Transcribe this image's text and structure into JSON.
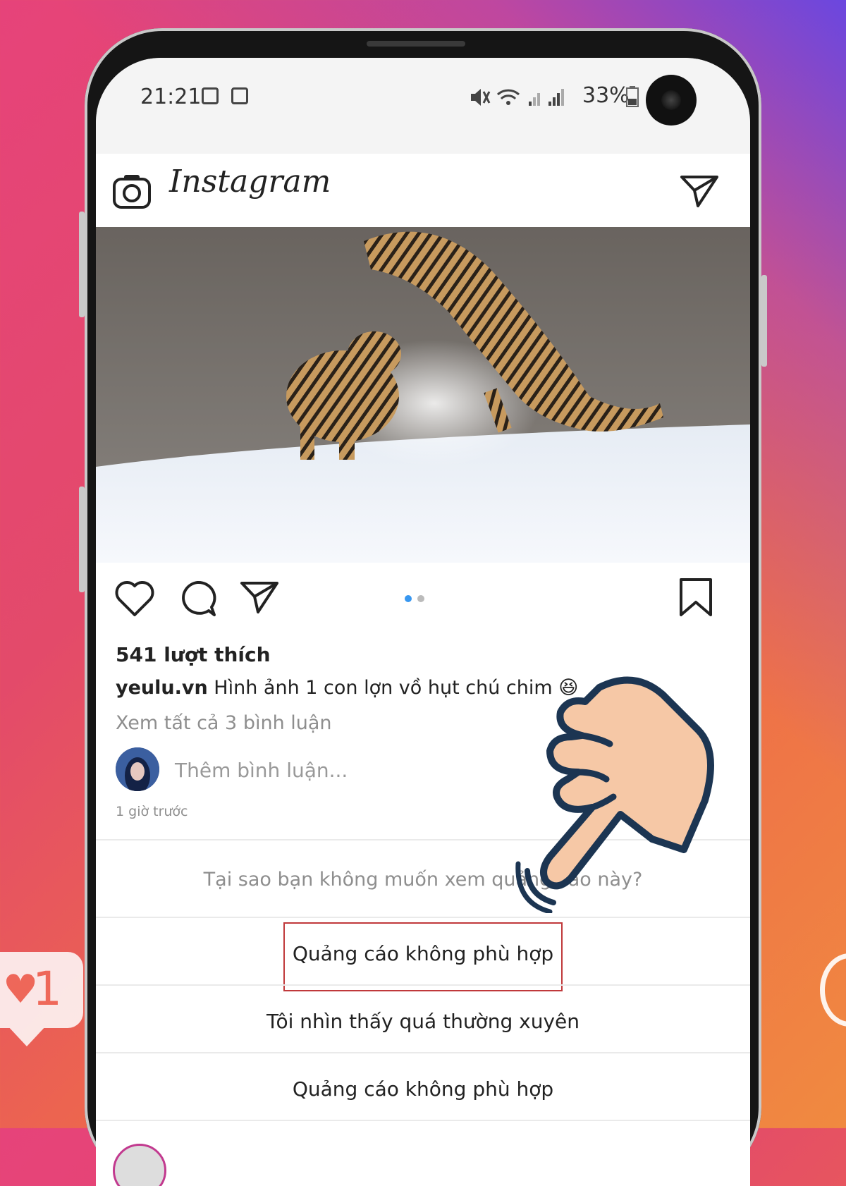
{
  "status_bar": {
    "time": "21:21",
    "battery": "33%"
  },
  "app": {
    "name": "Instagram"
  },
  "post": {
    "likes": "541 lượt thích",
    "username": "yeulu.vn",
    "caption": "Hình ảnh 1 con lợn vồ hụt chú chim",
    "emoji": "😆",
    "view_comments": "Xem tất cả 3 bình luận",
    "comment_placeholder": "Thêm bình luận...",
    "time_ago": "1 giờ trước",
    "carousel_position": 1,
    "carousel_total": 2
  },
  "feedback": {
    "question": "Tại sao bạn không muốn xem quảng cáo này?",
    "options": [
      "Quảng cáo không phù hợp",
      "Tôi nhìn thấy quá thường xuyên",
      "Quảng cáo không phù hợp"
    ]
  },
  "notification": {
    "like_count": "1"
  },
  "colors": {
    "accent_blue": "#3897f0",
    "highlight_border": "#c0393b",
    "hand_skin": "#f6c8a6",
    "hand_outline": "#1c3552"
  }
}
